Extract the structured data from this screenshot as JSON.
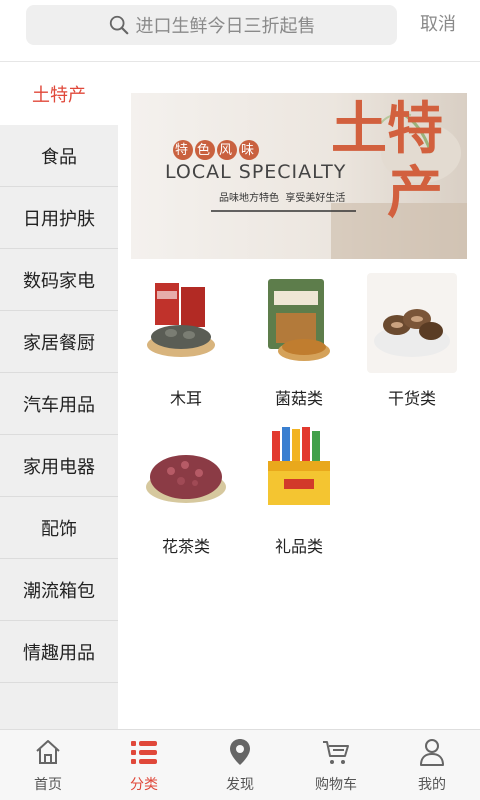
{
  "search": {
    "placeholder": "进口生鲜今日三折起售",
    "cancel_label": "取消"
  },
  "sidebar": {
    "items": [
      {
        "label": "土特产",
        "active": true
      },
      {
        "label": "食品"
      },
      {
        "label": "日用护肤"
      },
      {
        "label": "数码家电"
      },
      {
        "label": "家居餐厨"
      },
      {
        "label": "汽车用品"
      },
      {
        "label": "家用电器"
      },
      {
        "label": "配饰"
      },
      {
        "label": "潮流箱包"
      },
      {
        "label": "情趣用品"
      }
    ]
  },
  "banner": {
    "tag": "特色风味",
    "title_en": "LOCAL SPECIALTY",
    "slogan": "品味地方特色  享受美好生活",
    "title_cn": "土特产"
  },
  "products": [
    {
      "name": "木耳",
      "icon": "tea-can-icon"
    },
    {
      "name": "菌菇类",
      "icon": "mushroom-bag-icon"
    },
    {
      "name": "干货类",
      "icon": "shiitake-bowl-icon"
    },
    {
      "name": "花茶类",
      "icon": "rose-tea-icon"
    },
    {
      "name": "礼品类",
      "icon": "gift-box-icon"
    }
  ],
  "tabbar": {
    "items": [
      {
        "label": "首页",
        "icon": "home-icon"
      },
      {
        "label": "分类",
        "icon": "category-icon",
        "active": true
      },
      {
        "label": "发现",
        "icon": "location-pin-icon"
      },
      {
        "label": "购物车",
        "icon": "cart-icon"
      },
      {
        "label": "我的",
        "icon": "user-icon"
      }
    ]
  },
  "colors": {
    "accent": "#e0483a",
    "banner_text": "#d2603e",
    "sidebar_bg": "#efefef"
  }
}
